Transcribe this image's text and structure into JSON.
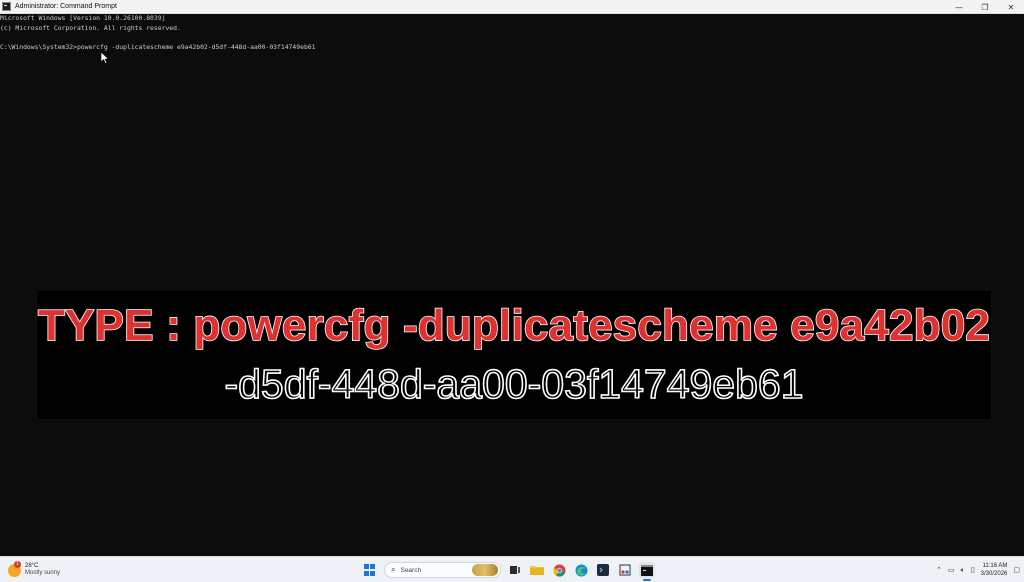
{
  "window": {
    "title": "Administrator: Command Prompt",
    "minimize_glyph": "—",
    "maximize_glyph": "❐",
    "close_glyph": "✕"
  },
  "console": {
    "lines": [
      "Microsoft Windows [Version 10.0.26100.8039]",
      "(c) Microsoft Corporation. All rights reserved.",
      "",
      "C:\\Windows\\System32>powercfg -duplicatescheme e9a42b02-d5df-448d-aa00-03f14749eb61"
    ]
  },
  "banner": {
    "line1": "TYPE : powercfg -duplicatescheme e9a42b02",
    "line2": "-d5df-448d-aa00-03f14749eb61",
    "accent_color": "#e03131"
  },
  "taskbar": {
    "weather": {
      "temp": "28°C",
      "condition": "Mostly sunny",
      "badge": "1"
    },
    "search": {
      "placeholder": "Search"
    },
    "apps": [
      "start-icon",
      "search-box",
      "task-view-icon",
      "file-explorer-icon",
      "chrome-icon",
      "edge-icon",
      "terminal-icon",
      "snipping-icon",
      "command-prompt-icon"
    ],
    "clock": {
      "time": "11:16 AM",
      "date": "3/30/2026"
    }
  }
}
